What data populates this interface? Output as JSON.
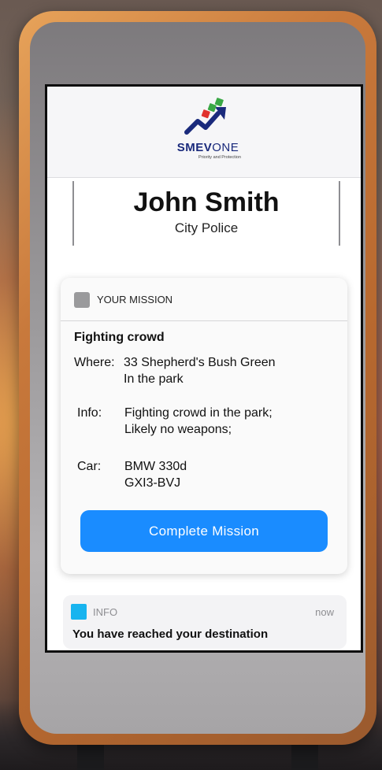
{
  "app": {
    "logo_text_bold": "SMEV",
    "logo_text_light": "ONE",
    "logo_tagline": "Priority and Protection"
  },
  "officer": {
    "name": "John Smith",
    "unit": "City Police"
  },
  "mission_card": {
    "header_title": "YOUR MISSION",
    "mission_name": "Fighting crowd",
    "where_label": "Where:",
    "where_line1": "33 Shepherd's Bush Green",
    "where_line2": "In the park",
    "info_label": "Info:",
    "info_line1": "Fighting crowd in the park;",
    "info_line2": "Likely no weapons;",
    "car_label": "Car:",
    "car_line1": "BMW 330d",
    "car_line2": "GXI3-BVJ",
    "complete_button": "Complete Mission"
  },
  "notification": {
    "label": "INFO",
    "time": "now",
    "message": "You have reached your destination"
  },
  "colors": {
    "accent_button": "#1a8cff",
    "notification_icon": "#18b4ef",
    "logo_navy": "#1a2a7c",
    "logo_green": "#3aa845",
    "logo_red": "#e0322d"
  },
  "icons": {
    "card_icon": "mission-icon",
    "notification_icon": "info-icon",
    "logo": "smevone-logo-icon"
  }
}
